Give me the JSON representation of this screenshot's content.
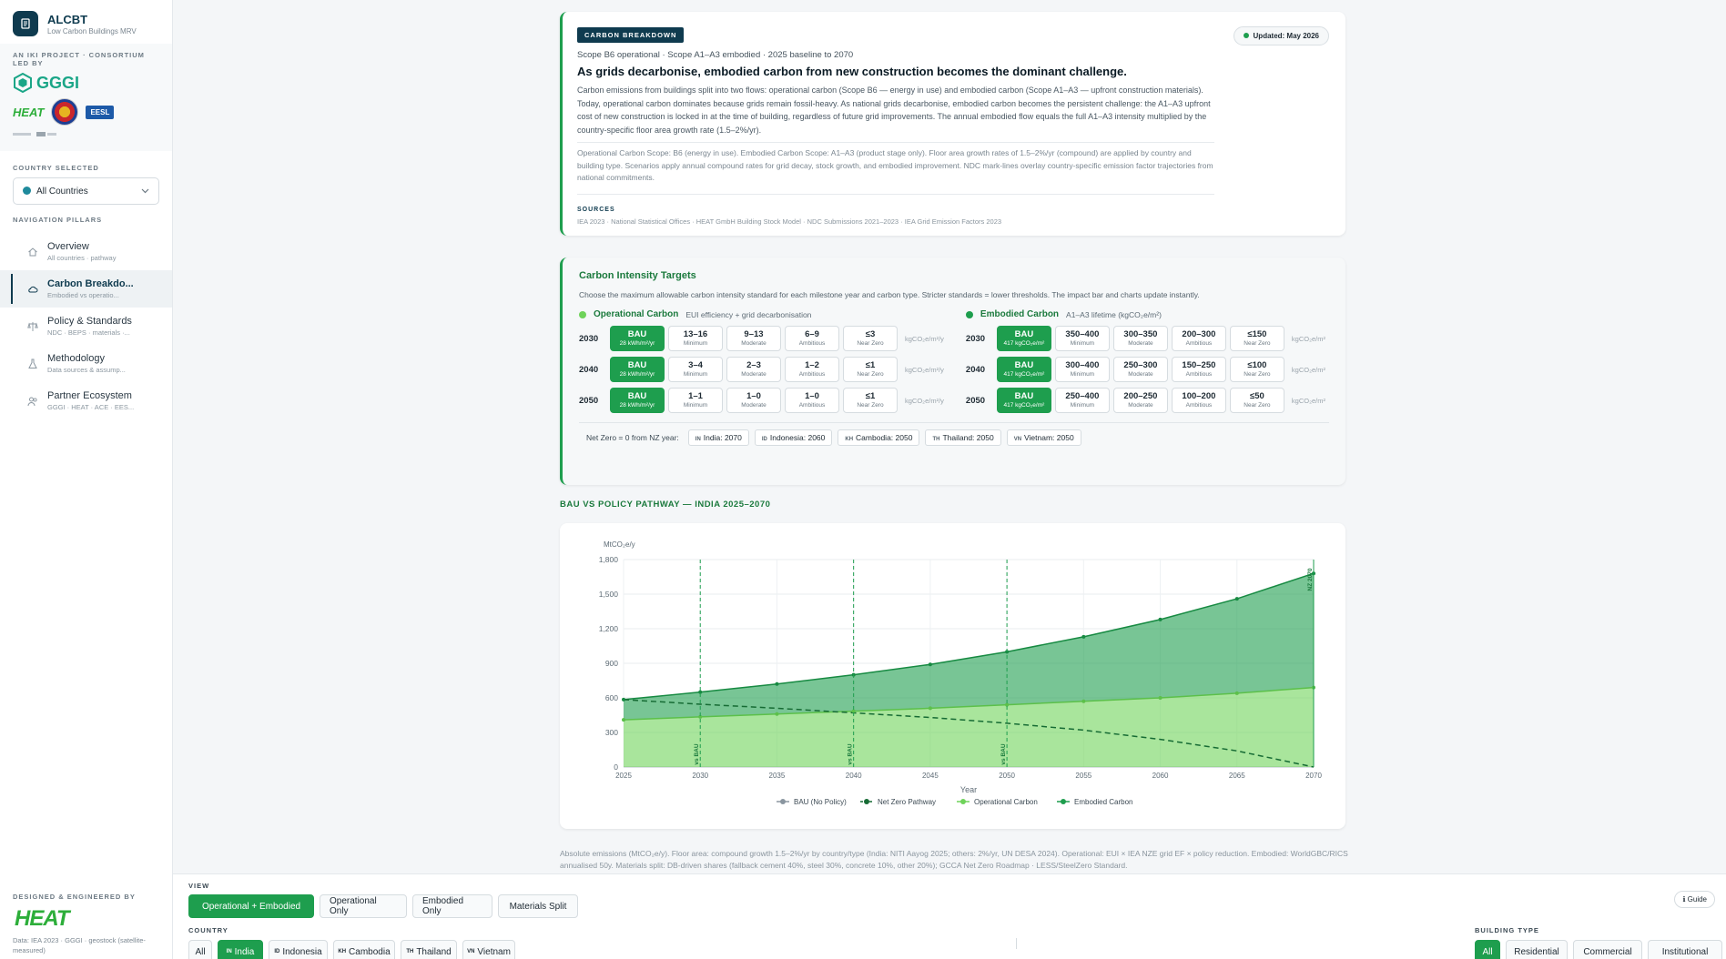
{
  "brand": {
    "title_a": "ALC",
    "title_b": "BT",
    "subtitle": "Low Carbon Buildings MRV"
  },
  "sidebar": {
    "consortium_caption": "AN IKI PROJECT · CONSORTIUM LED BY",
    "partner_logos": {
      "gggi": "GGGI",
      "heat": "HEAT",
      "eesl": "EESL"
    },
    "country_caption": "COUNTRY SELECTED",
    "country_value": "All Countries",
    "nav_caption": "NAVIGATION PILLARS",
    "nav": [
      {
        "label": "Overview",
        "sub": "All countries · pathway",
        "icon": "home-icon"
      },
      {
        "label": "Carbon Breakdo...",
        "sub": "Embodied vs operatio...",
        "icon": "cloud-icon"
      },
      {
        "label": "Policy & Standards",
        "sub": "NDC · BEPS · materials ·...",
        "icon": "scale-icon"
      },
      {
        "label": "Methodology",
        "sub": "Data sources & assump...",
        "icon": "flask-icon"
      },
      {
        "label": "Partner Ecosystem",
        "sub": "GGGI · HEAT · ACE · EES...",
        "icon": "people-icon"
      }
    ],
    "foot_caption": "DESIGNED & ENGINEERED BY",
    "foot_logo": "HEAT",
    "foot_data": "Data: IEA 2023 · GGGI · geostock (satellite-measured)"
  },
  "hero": {
    "tag": "CARBON BREAKDOWN",
    "updated": "Updated: May 2026",
    "scope": "Scope B6 operational · Scope A1–A3 embodied · 2025 baseline to 2070",
    "title": "As grids decarbonise, embodied carbon from new construction becomes the dominant challenge.",
    "body": "Carbon emissions from buildings split into two flows: operational carbon (Scope B6 — energy in use) and embodied carbon (Scope A1–A3 — upfront construction materials). Today, operational carbon dominates because grids remain fossil-heavy. As national grids decarbonise, embodied carbon becomes the persistent challenge: the A1–A3 upfront cost of new construction is locked in at the time of building, regardless of future grid improvements. The annual embodied flow equals the full A1–A3 intensity multiplied by the country-specific floor area growth rate (1.5–2%/yr).",
    "method": "Operational Carbon Scope: B6 (energy in use). Embodied Carbon Scope: A1–A3 (product stage only). Floor area growth rates of 1.5–2%/yr (compound) are applied by country and building type. Scenarios apply annual compound rates for grid decay, stock growth, and embodied improvement. NDC mark-lines overlay country-specific emission factor trajectories from national commitments.",
    "sources_caption": "SOURCES",
    "sources": "IEA 2023 · National Statistical Offices · HEAT GmbH Building Stock Model · NDC Submissions 2021–2023 · IEA Grid Emission Factors 2023"
  },
  "targets": {
    "title": "Carbon Intensity Targets",
    "desc": "Choose the maximum allowable carbon intensity standard for each milestone year and carbon type. Stricter standards = lower thresholds. The impact bar and charts update instantly.",
    "operational": {
      "name": "Operational Carbon",
      "hint": "EUI efficiency + grid decarbonisation",
      "unit": "kgCO₂e/m²/y",
      "rows": [
        {
          "year": "2030",
          "options": [
            {
              "v": "BAU",
              "s": "28 kWh/m²/yr"
            },
            {
              "v": "13–16",
              "s": "Minimum"
            },
            {
              "v": "9–13",
              "s": "Moderate"
            },
            {
              "v": "6–9",
              "s": "Ambitious"
            },
            {
              "v": "≤3",
              "s": "Near Zero"
            }
          ]
        },
        {
          "year": "2040",
          "options": [
            {
              "v": "BAU",
              "s": "28 kWh/m²/yr"
            },
            {
              "v": "3–4",
              "s": "Minimum"
            },
            {
              "v": "2–3",
              "s": "Moderate"
            },
            {
              "v": "1–2",
              "s": "Ambitious"
            },
            {
              "v": "≤1",
              "s": "Near Zero"
            }
          ]
        },
        {
          "year": "2050",
          "options": [
            {
              "v": "BAU",
              "s": "28 kWh/m²/yr"
            },
            {
              "v": "1–1",
              "s": "Minimum"
            },
            {
              "v": "1–0",
              "s": "Moderate"
            },
            {
              "v": "1–0",
              "s": "Ambitious"
            },
            {
              "v": "≤1",
              "s": "Near Zero"
            }
          ]
        }
      ]
    },
    "embodied": {
      "name": "Embodied Carbon",
      "hint": "A1–A3 lifetime (kgCO₂e/m²)",
      "unit": "kgCO₂e/m²",
      "rows": [
        {
          "year": "2030",
          "options": [
            {
              "v": "BAU",
              "s": "417 kgCO₂e/m²"
            },
            {
              "v": "350–400",
              "s": "Minimum"
            },
            {
              "v": "300–350",
              "s": "Moderate"
            },
            {
              "v": "200–300",
              "s": "Ambitious"
            },
            {
              "v": "≤150",
              "s": "Near Zero"
            }
          ]
        },
        {
          "year": "2040",
          "options": [
            {
              "v": "BAU",
              "s": "417 kgCO₂e/m²"
            },
            {
              "v": "300–400",
              "s": "Minimum"
            },
            {
              "v": "250–300",
              "s": "Moderate"
            },
            {
              "v": "150–250",
              "s": "Ambitious"
            },
            {
              "v": "≤100",
              "s": "Near Zero"
            }
          ]
        },
        {
          "year": "2050",
          "options": [
            {
              "v": "BAU",
              "s": "417 kgCO₂e/m²"
            },
            {
              "v": "250–400",
              "s": "Minimum"
            },
            {
              "v": "200–250",
              "s": "Moderate"
            },
            {
              "v": "100–200",
              "s": "Ambitious"
            },
            {
              "v": "≤50",
              "s": "Near Zero"
            }
          ]
        }
      ]
    },
    "nz_label": "Net Zero = 0 from NZ year:",
    "nz_chips": [
      {
        "code": "IN",
        "text": "India: 2070"
      },
      {
        "code": "ID",
        "text": "Indonesia: 2060"
      },
      {
        "code": "KH",
        "text": "Cambodia: 2050"
      },
      {
        "code": "TH",
        "text": "Thailand: 2050"
      },
      {
        "code": "VN",
        "text": "Vietnam: 2050"
      }
    ]
  },
  "section_title": "BAU VS POLICY PATHWAY — INDIA 2025–2070",
  "chart_data": {
    "type": "area",
    "ylabel": "MtCO₂e/y",
    "xlabel": "Year",
    "ylim": [
      0,
      1800
    ],
    "yticks": [
      0,
      300,
      600,
      900,
      1200,
      1500,
      1800
    ],
    "ytick_labels": [
      "0",
      "300",
      "600",
      "900",
      "1,200",
      "1,500",
      "1,800"
    ],
    "x": [
      2025,
      2030,
      2035,
      2040,
      2045,
      2050,
      2055,
      2060,
      2065,
      2070
    ],
    "series": [
      {
        "name": "BAU (No Policy)",
        "values": [
          585,
          650,
          720,
          800,
          890,
          1000,
          1130,
          1280,
          1460,
          1680
        ],
        "color": "#8a96a0"
      },
      {
        "name": "Net Zero Pathway",
        "values": [
          585,
          545,
          510,
          470,
          430,
          380,
          320,
          240,
          140,
          0
        ],
        "color": "#166b34"
      },
      {
        "name": "Operational Carbon",
        "values": [
          410,
          435,
          460,
          485,
          510,
          540,
          570,
          600,
          640,
          690
        ],
        "color": "#6fd35a"
      },
      {
        "name": "Embodied Carbon",
        "values": [
          585,
          650,
          720,
          800,
          890,
          1000,
          1130,
          1280,
          1460,
          1680
        ],
        "color": "#1e9e4e"
      }
    ],
    "markers": [
      {
        "x": 2030,
        "label": "vs BAU"
      },
      {
        "x": 2040,
        "label": "vs BAU"
      },
      {
        "x": 2050,
        "label": "vs BAU"
      },
      {
        "x": 2070,
        "label": "NZ 2070"
      }
    ],
    "legend": "bottom",
    "grid": true
  },
  "chart_note": "Absolute emissions (MtCO₂e/y). Floor area: compound growth 1.5–2%/yr by country/type (India: NITI Aayog 2025; others: 2%/yr, UN DESA 2024). Operational: EUI × IEA NZE grid EF × policy reduction. Embodied: WorldGBC/RICS annualised 50y. Materials split: DB-driven shares (fallback cement 40%, steel 30%, concrete 10%, other 20%); GCCA Net Zero Roadmap · LESS/SteelZero Standard.",
  "controls": {
    "view_caption": "VIEW",
    "views": [
      "Operational + Embodied",
      "Operational Only",
      "Embodied Only",
      "Materials Split"
    ],
    "guide": "ℹ Guide",
    "country_caption": "COUNTRY",
    "countries": [
      {
        "code": "",
        "label": "All"
      },
      {
        "code": "IN",
        "label": "India"
      },
      {
        "code": "ID",
        "label": "Indonesia"
      },
      {
        "code": "KH",
        "label": "Cambodia"
      },
      {
        "code": "TH",
        "label": "Thailand"
      },
      {
        "code": "VN",
        "label": "Vietnam"
      }
    ],
    "building_caption": "BUILDING TYPE",
    "buildings": [
      "All",
      "Residential",
      "Commercial",
      "Institutional"
    ]
  }
}
